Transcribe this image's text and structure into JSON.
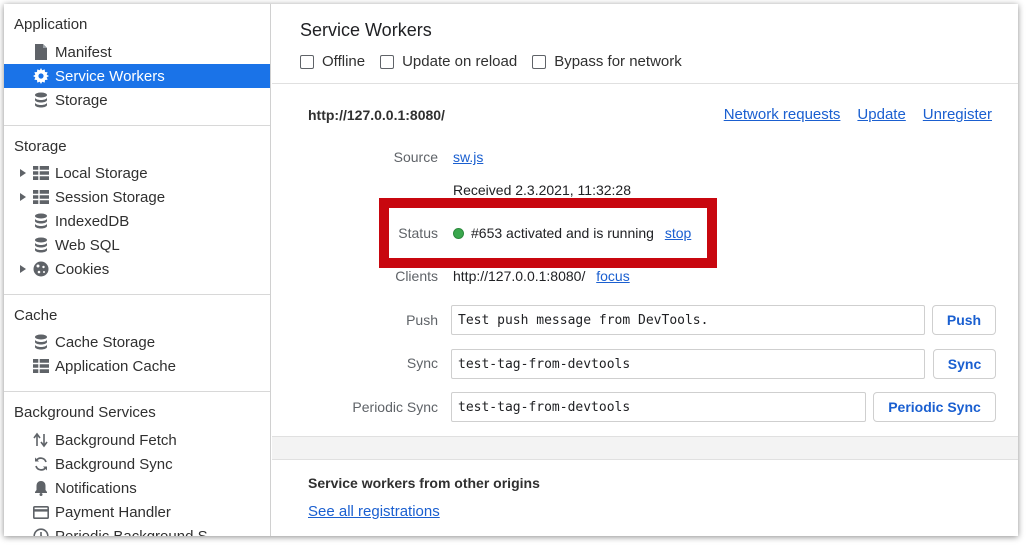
{
  "sidebar": {
    "application": {
      "title": "Application",
      "items": [
        {
          "label": "Manifest",
          "icon": "document-icon"
        },
        {
          "label": "Service Workers",
          "icon": "gear-icon",
          "selected": true
        },
        {
          "label": "Storage",
          "icon": "database-icon"
        }
      ]
    },
    "storage": {
      "title": "Storage",
      "items": [
        {
          "label": "Local Storage",
          "icon": "grid-icon",
          "expandable": true
        },
        {
          "label": "Session Storage",
          "icon": "grid-icon",
          "expandable": true
        },
        {
          "label": "IndexedDB",
          "icon": "database-icon"
        },
        {
          "label": "Web SQL",
          "icon": "database-icon"
        },
        {
          "label": "Cookies",
          "icon": "cookie-icon",
          "expandable": true
        }
      ]
    },
    "cache": {
      "title": "Cache",
      "items": [
        {
          "label": "Cache Storage",
          "icon": "database-icon"
        },
        {
          "label": "Application Cache",
          "icon": "grid-icon"
        }
      ]
    },
    "background": {
      "title": "Background Services",
      "items": [
        {
          "label": "Background Fetch",
          "icon": "arrows-updown-icon"
        },
        {
          "label": "Background Sync",
          "icon": "sync-icon"
        },
        {
          "label": "Notifications",
          "icon": "bell-icon"
        },
        {
          "label": "Payment Handler",
          "icon": "card-icon"
        },
        {
          "label": "Periodic Background S...",
          "icon": "clock-icon"
        }
      ]
    }
  },
  "main": {
    "title": "Service Workers",
    "options": [
      {
        "label": "Offline",
        "checked": false
      },
      {
        "label": "Update on reload",
        "checked": false
      },
      {
        "label": "Bypass for network",
        "checked": false
      }
    ],
    "worker": {
      "origin": "http://127.0.0.1:8080/",
      "links": [
        "Network requests",
        "Update",
        "Unregister"
      ],
      "source_label": "Source",
      "source_value": "sw.js",
      "received": "Received 2.3.2021, 11:32:28",
      "status_label": "Status",
      "status_text": "#653 activated and is running",
      "status_color": "#3aa74d",
      "stop_label": "stop",
      "clients_label": "Clients",
      "clients_value": "http://127.0.0.1:8080/",
      "focus_label": "focus",
      "push_label": "Push",
      "push_value": "Test push message from DevTools.",
      "push_button": "Push",
      "sync_label": "Sync",
      "sync_value": "test-tag-from-devtools",
      "sync_button": "Sync",
      "periodic_label": "Periodic Sync",
      "periodic_value": "test-tag-from-devtools",
      "periodic_button": "Periodic Sync"
    },
    "other_origins_title": "Service workers from other origins",
    "see_all_label": "See all registrations"
  },
  "colors": {
    "accent": "#1a73e8",
    "link": "#1a5fd0",
    "highlight": "#c8070f"
  }
}
